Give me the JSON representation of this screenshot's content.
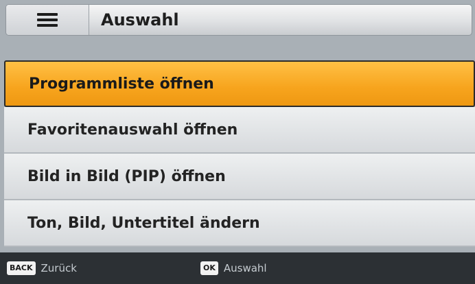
{
  "header": {
    "menu_icon": "hamburger-icon",
    "title": "Auswahl"
  },
  "menu": {
    "selected_index": 0,
    "items": [
      {
        "label": "Programmliste öffnen"
      },
      {
        "label": "Favoritenauswahl öffnen"
      },
      {
        "label": "Bild in Bild (PIP) öffnen"
      },
      {
        "label": "Ton, Bild, Untertitel ändern"
      }
    ]
  },
  "footer": {
    "back": {
      "key": "BACK",
      "label": "Zurück"
    },
    "ok": {
      "key": "OK",
      "label": "Auswahl"
    }
  },
  "colors": {
    "highlight": "#f7a41d",
    "background": "#a9b0b6",
    "footer": "#2c3034"
  }
}
